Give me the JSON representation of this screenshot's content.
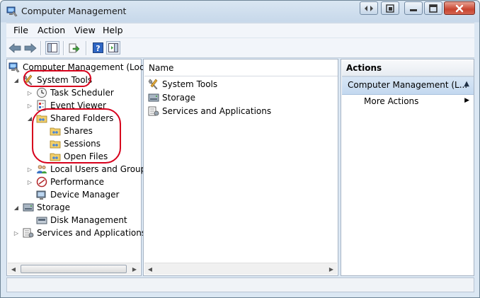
{
  "window": {
    "title": "Computer Management"
  },
  "menu": [
    "File",
    "Action",
    "View",
    "Help"
  ],
  "toolbar": [
    "back-arrow-icon",
    "forward-arrow-icon",
    "show-hide-tree-icon",
    "export-list-icon",
    "help-icon",
    "show-hide-action-pane-icon"
  ],
  "tree": {
    "root": "Computer Management (Local",
    "system_tools": "System Tools",
    "task_scheduler": "Task Scheduler",
    "event_viewer": "Event Viewer",
    "shared_folders": "Shared Folders",
    "shares": "Shares",
    "sessions": "Sessions",
    "open_files": "Open Files",
    "local_users": "Local Users and Groups",
    "performance": "Performance",
    "device_manager": "Device Manager",
    "storage": "Storage",
    "disk_management": "Disk Management",
    "services": "Services and Applications"
  },
  "list": {
    "column_name": "Name",
    "items": [
      "System Tools",
      "Storage",
      "Services and Applications"
    ]
  },
  "actions": {
    "header": "Actions",
    "selected": "Computer Management (L...",
    "more": "More Actions"
  },
  "colors": {
    "annotation": "#d7001c",
    "selection": "#c3d8ef",
    "frame": "#dbe7f3"
  }
}
